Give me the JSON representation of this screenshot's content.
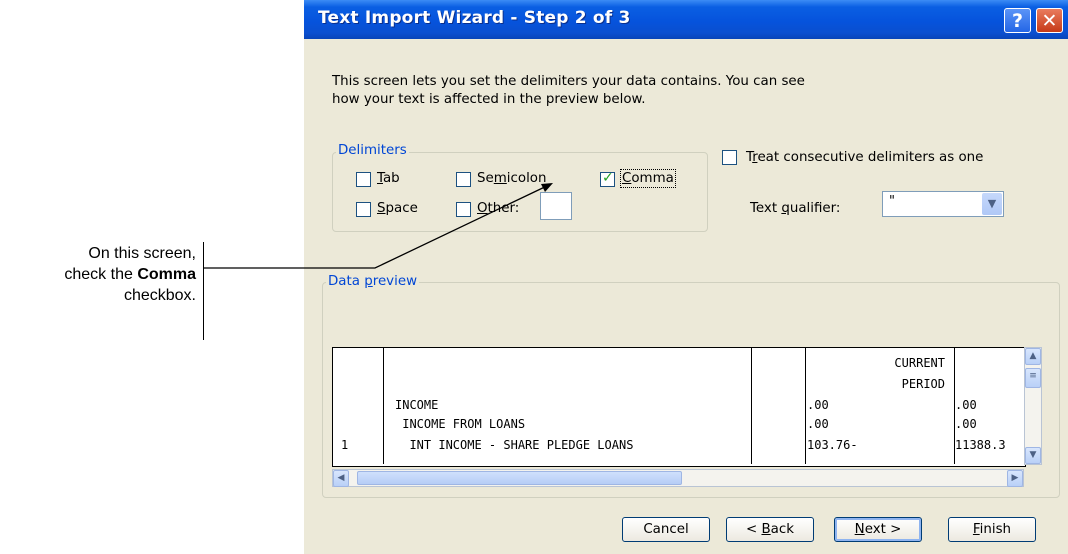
{
  "callout": {
    "line1": "On this screen,",
    "line2a": "check the ",
    "line2b": "Comma",
    "line3": "checkbox."
  },
  "window": {
    "title": "Text Import Wizard - Step 2 of 3",
    "help_icon": "?",
    "close_icon": "✕"
  },
  "intro": {
    "line1": "This screen lets you set the delimiters your data contains.  You can see",
    "line2": "how your text is affected in the preview below."
  },
  "delimiters": {
    "legend": "Delimiters",
    "tab": {
      "label_u": "T",
      "label_rest": "ab",
      "checked": false
    },
    "semicolon": {
      "label_pre": "Se",
      "label_u": "m",
      "label_rest": "icolon",
      "checked": false
    },
    "comma": {
      "label_u": "C",
      "label_rest": "omma",
      "checked": true
    },
    "space": {
      "label_u": "S",
      "label_rest": "pace",
      "checked": false
    },
    "other": {
      "label_u": "O",
      "label_rest": "ther:",
      "checked": false,
      "value": ""
    }
  },
  "consecutive": {
    "label_pre": "T",
    "label_u": "r",
    "label_rest": "eat consecutive delimiters as one",
    "checked": false
  },
  "qualifier": {
    "label_pre": "Text ",
    "label_u": "q",
    "label_rest": "ualifier:",
    "value": "\""
  },
  "preview": {
    "legend_pre": "Data ",
    "legend_u": "p",
    "legend_rest": "review",
    "rows": [
      [
        "",
        "",
        "",
        "CURRENT",
        ""
      ],
      [
        "",
        "",
        "",
        "PERIOD",
        ""
      ],
      [
        "",
        "INCOME",
        "",
        ".00",
        ".00"
      ],
      [
        "",
        " INCOME FROM LOANS",
        "",
        ".00",
        ".00"
      ],
      [
        "1",
        "  INT INCOME - SHARE PLEDGE LOANS",
        "",
        "103.76-",
        "11388.3"
      ]
    ]
  },
  "buttons": {
    "cancel": "Cancel",
    "back_pre": "< ",
    "back_u": "B",
    "back_rest": "ack",
    "next_u": "N",
    "next_rest": "ext >",
    "finish_u": "F",
    "finish_rest": "inish"
  },
  "colors": {
    "titlebar": "#0653dc",
    "window_bg": "#ece9d8",
    "legend": "#0046d5",
    "checkmark": "#21a121"
  }
}
